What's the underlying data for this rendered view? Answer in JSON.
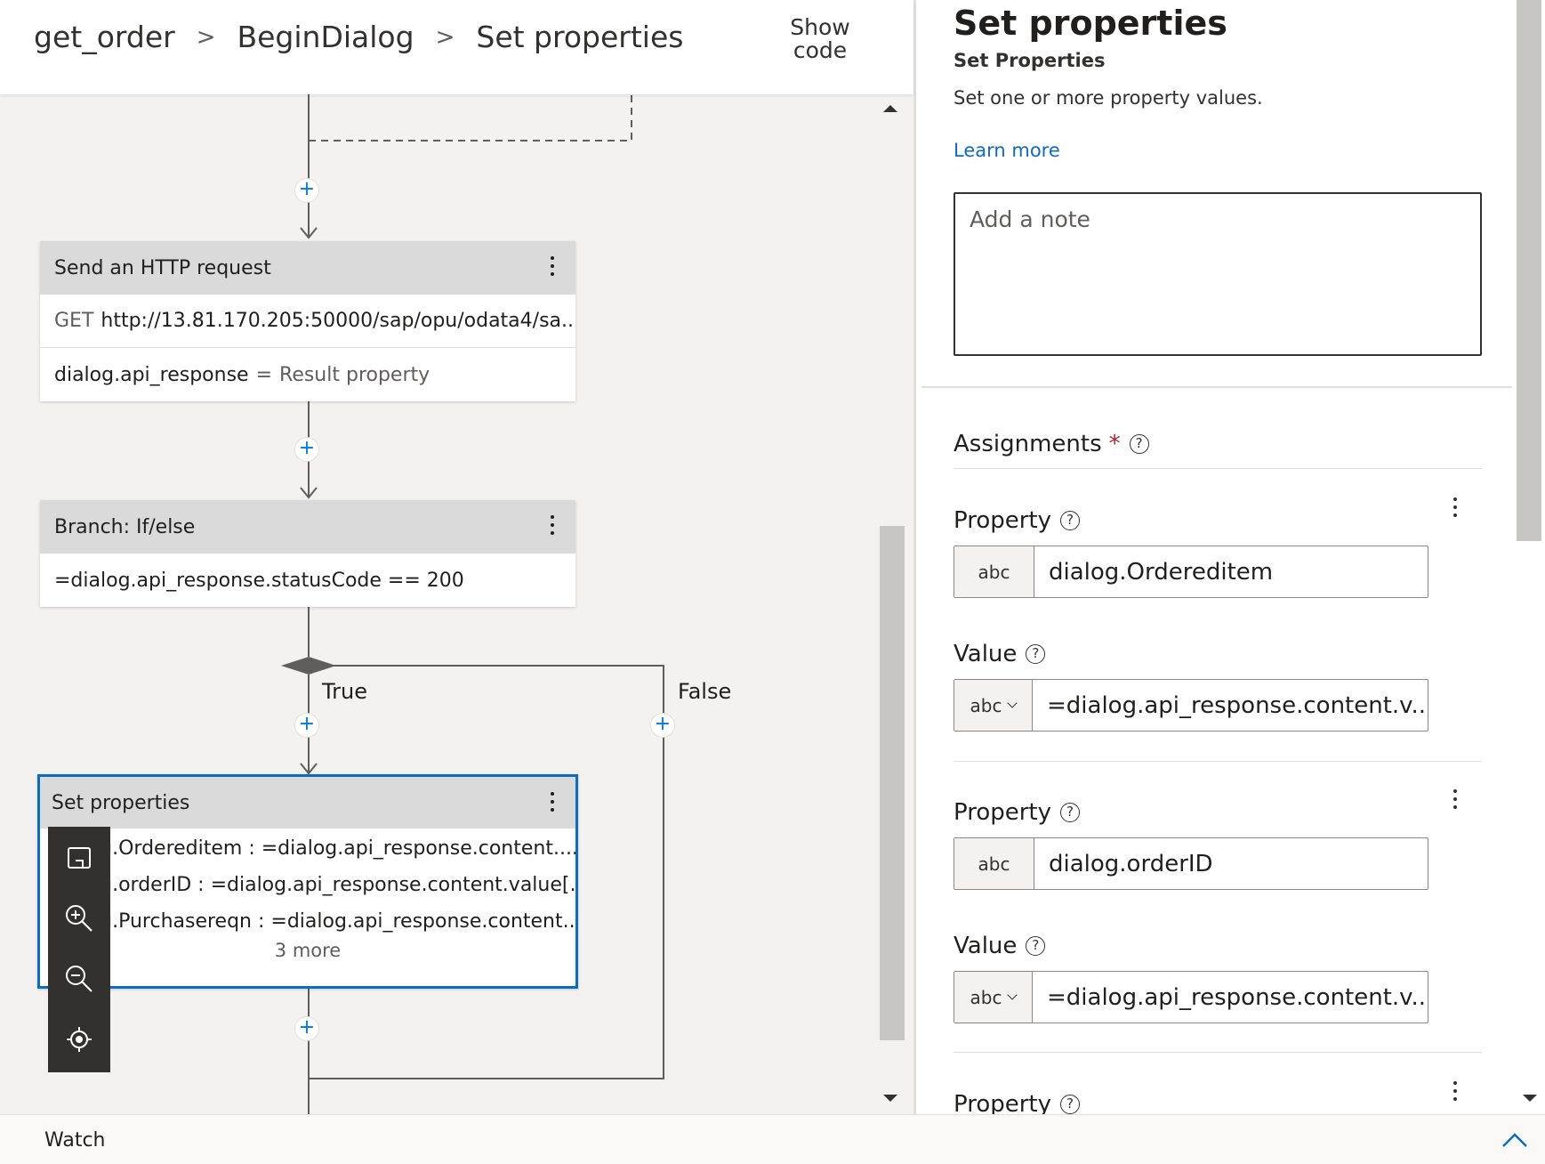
{
  "breadcrumb": {
    "items": [
      "get_order",
      "BeginDialog",
      "Set properties"
    ],
    "separator": ">"
  },
  "show_code": {
    "line1": "Show",
    "line2": "code"
  },
  "canvas": {
    "http_node": {
      "title": "Send an HTTP request",
      "method": "GET",
      "url": "http://13.81.170.205:50000/sap/opu/odata4/sa...",
      "result_var": "dialog.api_response",
      "result_eq": "=",
      "result_label": "Result property"
    },
    "branch_node": {
      "title": "Branch: If/else",
      "condition": "=dialog.api_response.statusCode == 200"
    },
    "branch_labels": {
      "true_label": "True",
      "false_label": "False"
    },
    "setprops_node": {
      "title": "Set properties",
      "lines": [
        "dialog.Ordereditem : =dialog.api_response.content....",
        "dialog.orderID : =dialog.api_response.content.value[...",
        "dialog.Purchasereqn : =dialog.api_response.content...."
      ],
      "more": "3 more"
    },
    "add_glyph": "+",
    "zoom_tools": [
      "fit-to-screen-icon",
      "zoom-in-icon",
      "zoom-out-icon",
      "center-icon"
    ]
  },
  "properties_panel": {
    "title": "Set properties",
    "subtitle": "Set Properties",
    "description": "Set one or more property values.",
    "learn_more": "Learn more",
    "note_placeholder": "Add a note",
    "assignments_label": "Assignments",
    "required_marker": "*",
    "help_glyph": "?",
    "assignments": [
      {
        "property_label": "Property",
        "property_type": "abc",
        "property_value": "dialog.Ordereditem",
        "value_label": "Value",
        "value_type": "abc",
        "value_value": "=dialog.api_response.content.v..."
      },
      {
        "property_label": "Property",
        "property_type": "abc",
        "property_value": "dialog.orderID",
        "value_label": "Value",
        "value_type": "abc",
        "value_value": "=dialog.api_response.content.v..."
      },
      {
        "property_label": "Property"
      }
    ]
  },
  "watch": {
    "label": "Watch"
  },
  "colors": {
    "accent": "#0f6cbd",
    "node_header": "#dadada",
    "canvas_bg": "#f3f2f1",
    "toolbar_bg": "#323130",
    "required": "#a4262c"
  }
}
